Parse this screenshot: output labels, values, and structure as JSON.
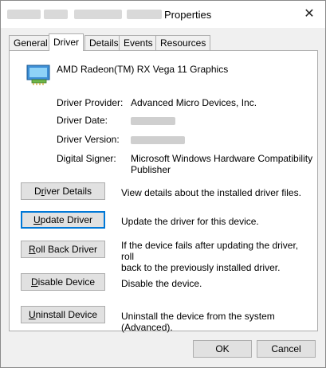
{
  "window": {
    "title": "Properties",
    "close_glyph": "✕"
  },
  "tabs": [
    {
      "label": "General"
    },
    {
      "label": "Driver"
    },
    {
      "label": "Details"
    },
    {
      "label": "Events"
    },
    {
      "label": "Resources"
    }
  ],
  "device": {
    "icon": "display-adapter-icon",
    "name": "AMD Radeon(TM) RX Vega 11 Graphics"
  },
  "info": {
    "provider_label": "Driver Provider:",
    "provider_value": "Advanced Micro Devices, Inc.",
    "date_label": "Driver Date:",
    "version_label": "Driver Version:",
    "signer_label": "Digital Signer:",
    "signer_value_line1": "Microsoft Windows Hardware Compatibility",
    "signer_value_line2": "Publisher"
  },
  "actions": [
    {
      "pre": "D",
      "ul": "r",
      "post": "iver Details",
      "desc": "View details about the installed driver files."
    },
    {
      "pre": "",
      "ul": "U",
      "post": "pdate Driver",
      "desc": "Update the driver for this device."
    },
    {
      "pre": "",
      "ul": "R",
      "post": "oll Back Driver",
      "desc_line1": "If the device fails after updating the driver, roll",
      "desc_line2": "back to the previously installed driver."
    },
    {
      "pre": "",
      "ul": "D",
      "post": "isable Device",
      "desc": "Disable the device."
    },
    {
      "pre": "",
      "ul": "U",
      "post": "ninstall Device",
      "desc": "Uninstall the device from the system (Advanced)."
    }
  ],
  "footer": {
    "ok": "OK",
    "cancel": "Cancel"
  },
  "colors": {
    "focus_border": "#0078d7",
    "button_face": "#e1e1e1"
  }
}
